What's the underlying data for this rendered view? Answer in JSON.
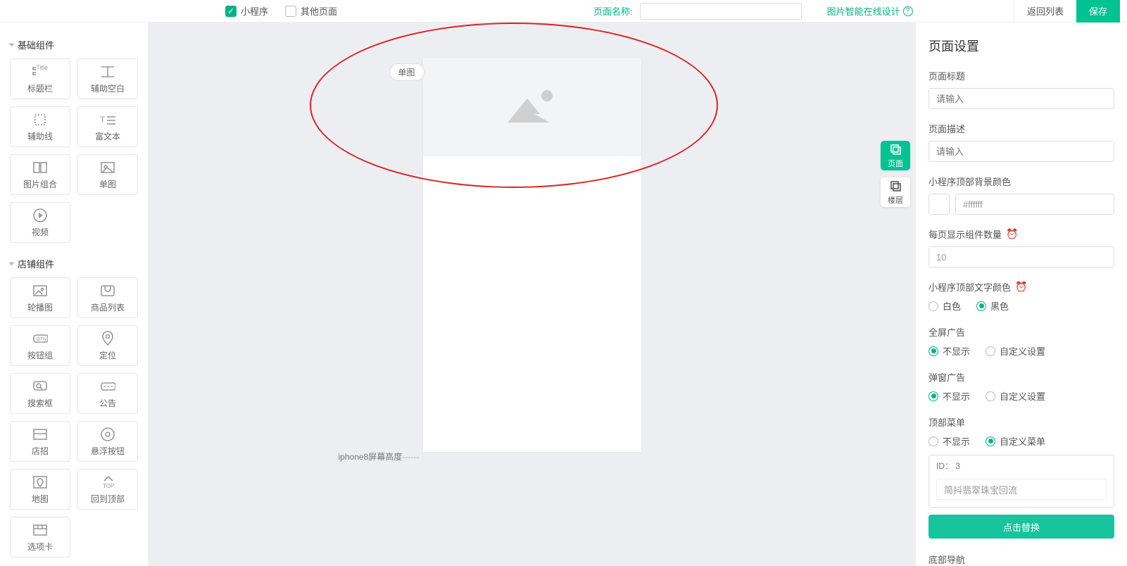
{
  "topbar": {
    "checks": [
      {
        "label": "小程序",
        "checked": true
      },
      {
        "label": "其他页面",
        "checked": false
      }
    ],
    "page_name_label": "页面名称:",
    "page_name_value": "",
    "design_link": "图片智能在线设计",
    "back": "返回列表",
    "save": "保存"
  },
  "palette": {
    "groups": [
      {
        "title": "基础组件",
        "items": [
          {
            "name": "title-icon",
            "label": "标题栏"
          },
          {
            "name": "spacer-icon",
            "label": "辅助空白"
          },
          {
            "name": "guide-icon",
            "label": "辅助线"
          },
          {
            "name": "richtext-icon",
            "label": "富文本"
          },
          {
            "name": "gallery-icon",
            "label": "图片组合"
          },
          {
            "name": "image-icon",
            "label": "单图"
          },
          {
            "name": "video-icon",
            "label": "视频"
          }
        ]
      },
      {
        "title": "店铺组件",
        "items": [
          {
            "name": "carousel-icon",
            "label": "轮播图"
          },
          {
            "name": "product-list-icon",
            "label": "商品列表"
          },
          {
            "name": "button-group-icon",
            "label": "按钮组"
          },
          {
            "name": "location-icon",
            "label": "定位"
          },
          {
            "name": "search-icon",
            "label": "搜索框"
          },
          {
            "name": "notice-icon",
            "label": "公告"
          },
          {
            "name": "shopfront-icon",
            "label": "店招"
          },
          {
            "name": "float-btn-icon",
            "label": "悬浮按钮"
          },
          {
            "name": "map-icon",
            "label": "地图"
          },
          {
            "name": "back-top-icon",
            "label": "回到顶部"
          },
          {
            "name": "tabs-icon",
            "label": "选项卡"
          }
        ]
      }
    ]
  },
  "canvas": {
    "tag": "单图",
    "iphone_label": "iphone8屏幕高度",
    "dashes": "------"
  },
  "side_tabs": [
    {
      "label": "页面",
      "active": true
    },
    {
      "label": "楼层",
      "active": false
    }
  ],
  "settings": {
    "title": "页面设置",
    "page_title_lbl": "页面标题",
    "page_title_ph": "请输入",
    "page_desc_lbl": "页面描述",
    "page_desc_ph": "请输入",
    "topbg_lbl": "小程序顶部背景颜色",
    "topbg_val": "#ffffff",
    "perpage_lbl": "每页显示组件数量",
    "perpage_val": "10",
    "textcolor_lbl": "小程序顶部文字颜色",
    "textcolor_opts": [
      "白色",
      "黑色"
    ],
    "textcolor_sel": 1,
    "fullad_lbl": "全屏广告",
    "fullad_opts": [
      "不显示",
      "自定义设置"
    ],
    "fullad_sel": 0,
    "popad_lbl": "弹窗广告",
    "popad_opts": [
      "不显示",
      "自定义设置"
    ],
    "popad_sel": 0,
    "topmenu_lbl": "顶部菜单",
    "topmenu_opts": [
      "不显示",
      "自定义菜单"
    ],
    "topmenu_sel": 1,
    "topmenu_id_lbl": "ID：",
    "topmenu_id": "3",
    "topmenu_name": "简抖翡翠珠宝回流",
    "topmenu_btn": "点击替换",
    "footer_nav_lbl": "底部导航"
  }
}
